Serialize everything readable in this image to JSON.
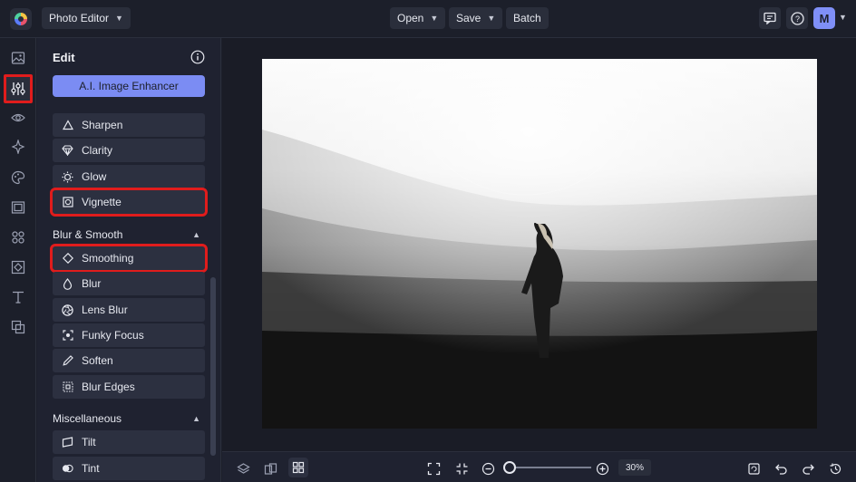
{
  "header": {
    "app_menu_label": "Photo Editor",
    "open_label": "Open",
    "save_label": "Save",
    "batch_label": "Batch",
    "avatar_initial": "M",
    "icons": [
      "logo-icon",
      "comment-icon",
      "help-icon",
      "chevron-down-icon"
    ]
  },
  "rail": {
    "items": [
      "image-icon",
      "adjustments-icon",
      "eye-icon",
      "effects-icon",
      "paint-icon",
      "frame-icon",
      "graphics-icon",
      "texture-icon",
      "text-icon",
      "overlay-icon"
    ],
    "active": "adjustments-icon"
  },
  "panel": {
    "title": "Edit",
    "ai_button_label": "A.I. Image Enhancer",
    "items_top": [
      {
        "label": "Sharpen",
        "icon": "triangle-icon"
      },
      {
        "label": "Clarity",
        "icon": "diamond-gem-icon"
      },
      {
        "label": "Glow",
        "icon": "glow-icon"
      },
      {
        "label": "Vignette",
        "icon": "vignette-icon",
        "highlighted": true
      }
    ],
    "section_blur": {
      "title": "Blur & Smooth",
      "items": [
        {
          "label": "Smoothing",
          "icon": "diamond-icon",
          "highlighted": true
        },
        {
          "label": "Blur",
          "icon": "drop-icon"
        },
        {
          "label": "Lens Blur",
          "icon": "aperture-icon"
        },
        {
          "label": "Funky Focus",
          "icon": "focus-icon"
        },
        {
          "label": "Soften",
          "icon": "pen-icon"
        },
        {
          "label": "Blur Edges",
          "icon": "blur-edges-icon"
        }
      ]
    },
    "section_misc": {
      "title": "Miscellaneous",
      "items": [
        {
          "label": "Tilt",
          "icon": "tilt-icon"
        },
        {
          "label": "Tint",
          "icon": "tint-icon"
        }
      ]
    }
  },
  "canvas": {
    "image": "foggy-field-woman-photo"
  },
  "footer": {
    "zoom_label": "30%",
    "zoom_level": 0.05,
    "colors": {
      "accent": "#7b8cf3",
      "highlight": "#e01c1c",
      "background": "#1c1f2a"
    }
  }
}
